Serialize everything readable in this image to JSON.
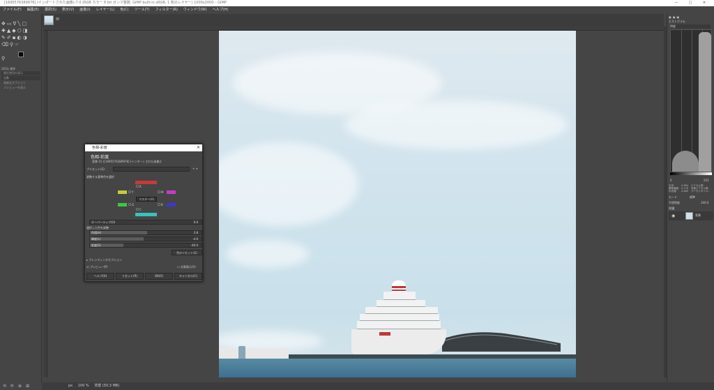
{
  "window": {
    "title": "[1695576389978] (インポートされた画像)-7.0 (RGB カラー 8 bit ガンマ整数, GIMP built-in sRGB, 1 枚のレイヤー) 1000x2000 – GIMP",
    "controls": [
      "—",
      "□",
      "✕"
    ]
  },
  "menu": [
    "ファイル(F)",
    "編集(E)",
    "選択(S)",
    "表示(V)",
    "画像(I)",
    "レイヤー(L)",
    "色(C)",
    "ツール(T)",
    "フィルター(R)",
    "ウィンドウ(W)",
    "ヘルプ(H)"
  ],
  "toolbox": {
    "rows": [
      "✥▭ᐁ╲▢",
      "✚▲◆⬡◨",
      "✎✐▪◐◑",
      "⌫⚲☞",
      "⚲"
    ],
    "options_title": "GEGL 操作",
    "options": [
      "最近使用の表示",
      "自動",
      "高度なオプション",
      "プレビューを表示"
    ]
  },
  "statusbar": {
    "unit": "px",
    "zoom": "100 %",
    "info": "背景 (50.3 MB)"
  },
  "dialog": {
    "title": "色相-彩度",
    "heading": "色相-彩度",
    "subheading": "背景-15 ([1695576389978] (インポートされた画像))",
    "preset_label": "プリセット(S):",
    "adjust_label": "調整する基準色を選択",
    "colors": {
      "R": "R",
      "Y": "Y",
      "G": "G",
      "C": "C",
      "B": "B",
      "M": "M"
    },
    "master_label": "マスター(A)",
    "overlap_label": "オーバーラップ(O)",
    "overlap_value": "0.0",
    "selected_label": "選択した色を調整",
    "hue_label": "色相(H)",
    "hue_value": "3.8",
    "light_label": "輝度(L)",
    "light_value": "-4.6",
    "sat_label": "彩度(S)",
    "sat_value": "-40.0",
    "reset_color": "色のリセット(E)",
    "blending": "ブレンディングオプション",
    "preview": "プレビュー(P)",
    "split_view": "分割表示(V)",
    "buttons": {
      "help": "ヘルプ(H)",
      "reset": "リセット(R)",
      "ok": "OK(O)",
      "cancel": "キャンセル(C)"
    }
  },
  "dock": {
    "histogram_title": "ヒストグラム",
    "channel": "明度",
    "range_low": "0",
    "range_high": "255",
    "stats_left": [
      "平均:",
      "標準偏差:",
      "中央値:"
    ],
    "stats_left_vals": [
      "0.664",
      "0.176",
      "0.689"
    ],
    "stats_right": [
      "ピクセル数:",
      "対象ピクセル数:",
      "パーセンタイル:"
    ],
    "mode_label": "モード",
    "mode_value": "標準",
    "opacity_label": "不透明度",
    "opacity_value": "100.0",
    "lock_label": "保護:",
    "layer_name": "背景"
  },
  "colors": {
    "red": "#c8393a",
    "yellow": "#c9c93a",
    "magenta": "#c93ac9",
    "green": "#3ac93a",
    "blue": "#3a3ac9",
    "cyan": "#38c2bb"
  }
}
